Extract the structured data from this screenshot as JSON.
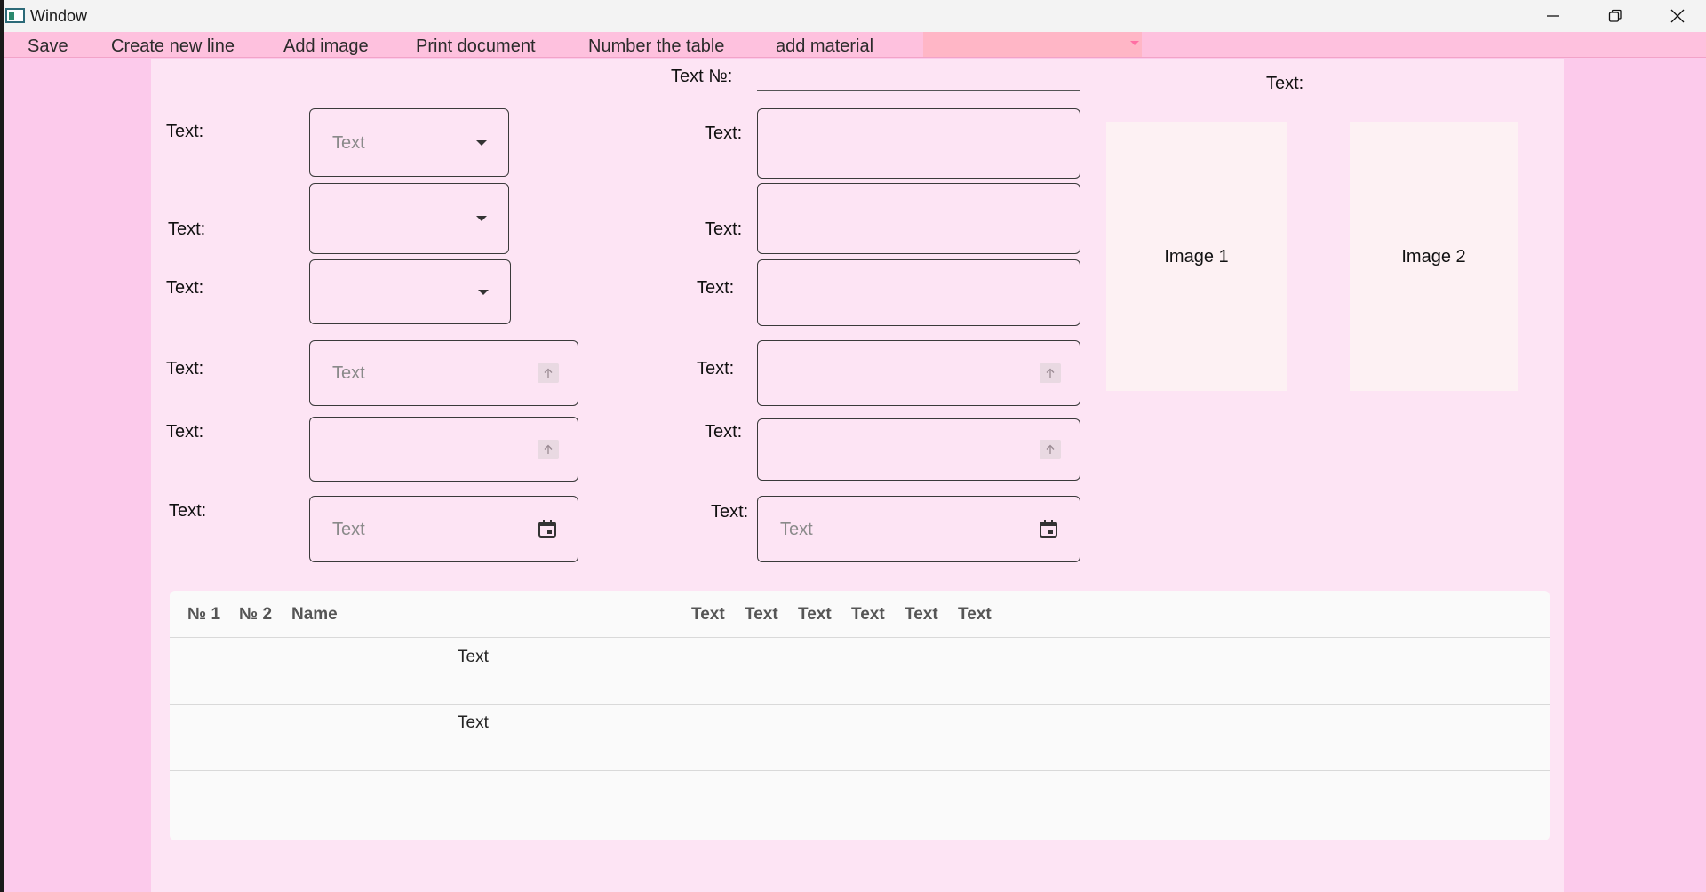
{
  "window": {
    "title": "Window"
  },
  "menu": {
    "items": [
      "Save",
      "Create new line",
      "Add image",
      "Print document",
      "Number the table",
      "add material"
    ]
  },
  "form": {
    "text_no_label": "Text №:",
    "left_labels": [
      "Text:",
      "Text:",
      "Text:",
      "Text:",
      "Text:",
      "Text:"
    ],
    "right_labels": [
      "Text:",
      "Text:",
      "Text:",
      "Text:",
      "Text:",
      "Text:"
    ],
    "select1_placeholder": "Text",
    "number1_placeholder": "Text",
    "date1_placeholder": "Text",
    "date2_placeholder": "Text",
    "images_label": "Text:",
    "image1_label": "Image 1",
    "image2_label": "Image 2"
  },
  "table": {
    "headers": [
      "№ 1",
      "№ 2",
      "Name",
      "Text",
      "Text",
      "Text",
      "Text",
      "Text",
      "Text"
    ],
    "rows": [
      {
        "name": "Text"
      },
      {
        "name": "Text"
      }
    ]
  }
}
